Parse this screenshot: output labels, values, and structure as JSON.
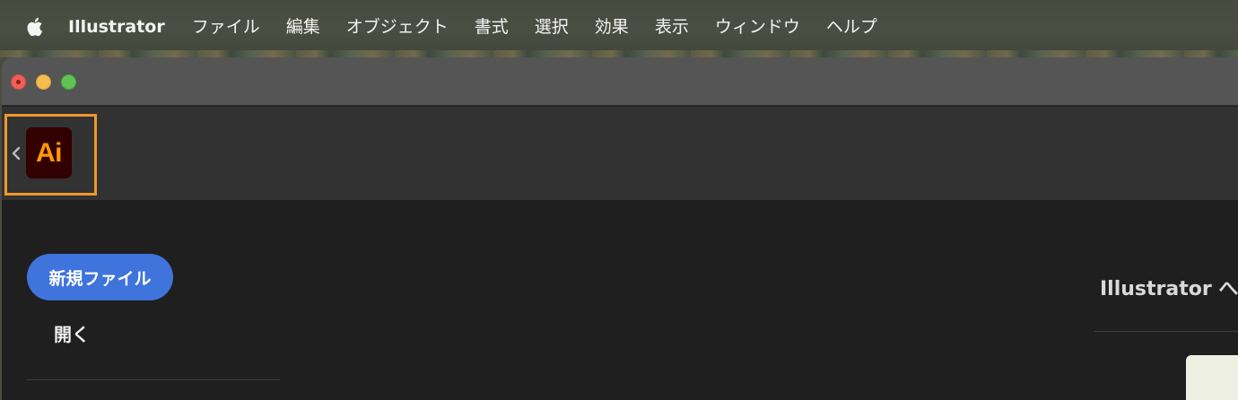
{
  "menubar": {
    "app_name": "Illustrator",
    "items": [
      "ファイル",
      "編集",
      "オブジェクト",
      "書式",
      "選択",
      "効果",
      "表示",
      "ウィンドウ",
      "ヘルプ"
    ]
  },
  "appbar": {
    "logo_text": "Ai",
    "logo_colors": {
      "background": "#330000",
      "foreground": "#ff9a00"
    },
    "highlight_color": "#f0982d"
  },
  "home": {
    "new_file_label": "新規ファイル",
    "open_label": "開く",
    "welcome_title": "Illustrator へよ"
  },
  "colors": {
    "accent": "#3f74dd",
    "window_bg": "#1f1f1f",
    "titlebar_bg": "#555555",
    "appbar_bg": "#323232"
  },
  "icons": [
    "apple-icon",
    "chevron-left-icon",
    "illustrator-app-icon"
  ]
}
